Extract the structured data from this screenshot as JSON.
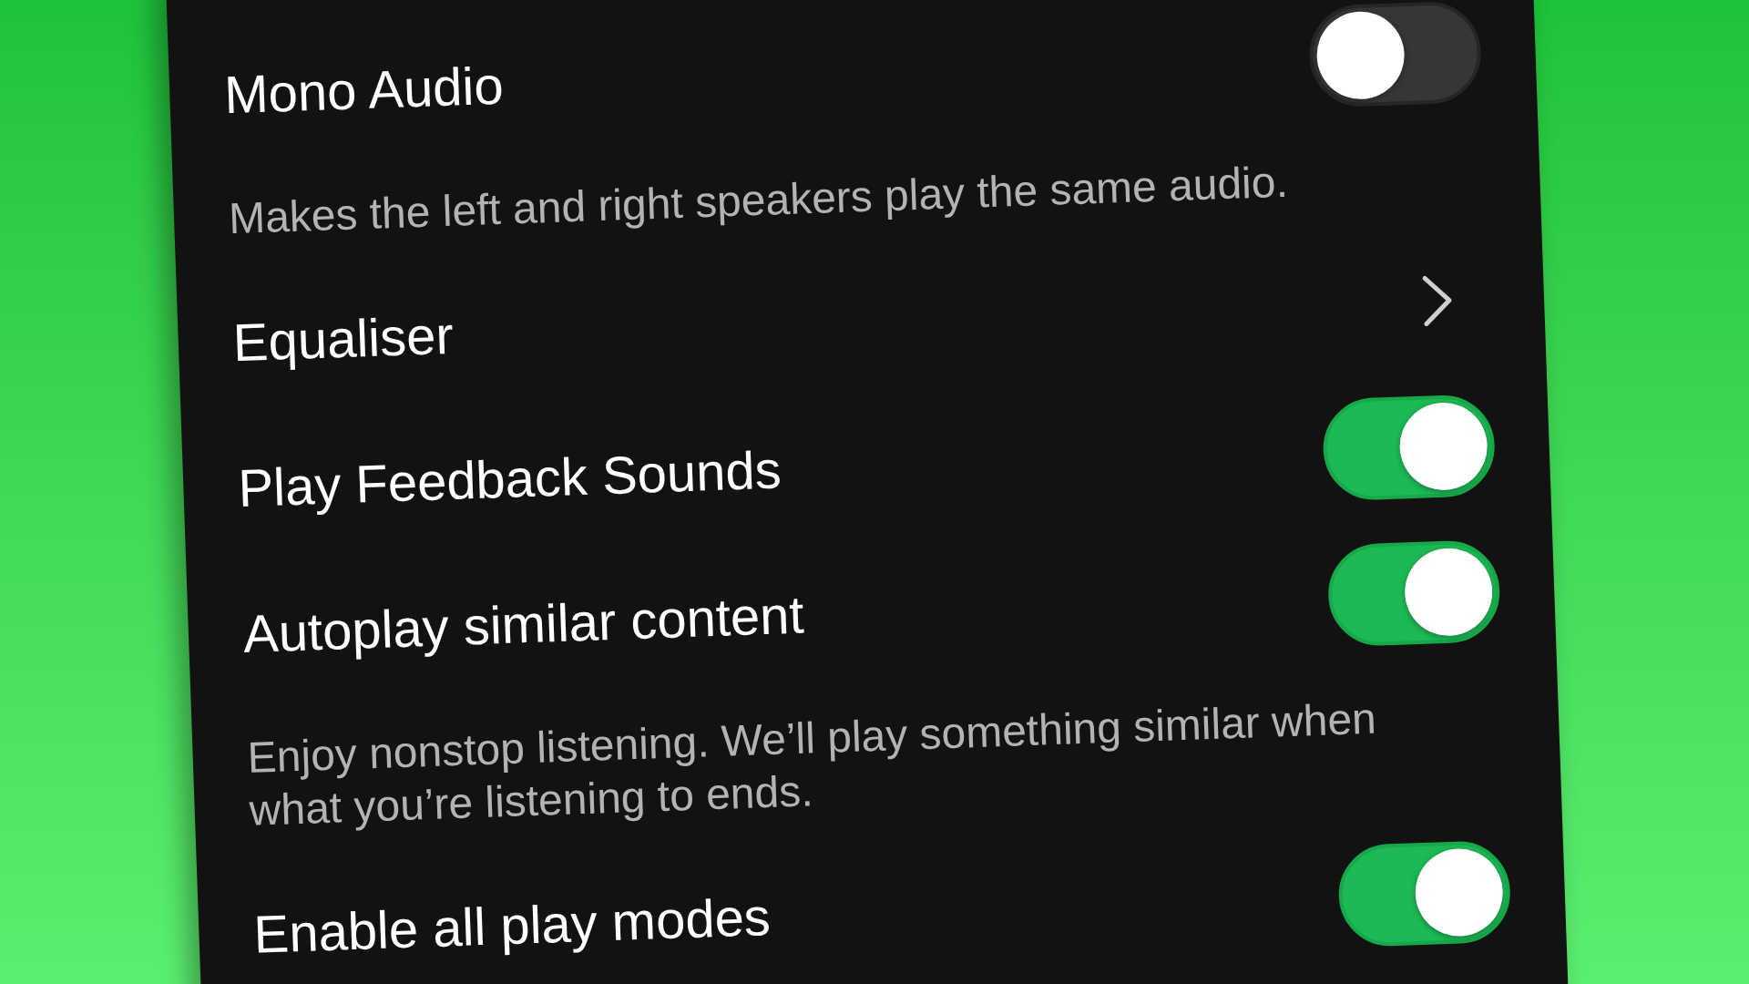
{
  "settings": [
    {
      "kind": "toggle",
      "label": "Mono Audio",
      "on": false,
      "description": "Makes the left and right speakers play the same audio."
    },
    {
      "kind": "link",
      "label": "Equaliser"
    },
    {
      "kind": "toggle",
      "label": "Play Feedback Sounds",
      "on": true
    },
    {
      "kind": "toggle",
      "label": "Autoplay similar content",
      "on": true,
      "description": "Enjoy nonstop listening. We’ll play something similar when what you’re listening to ends."
    },
    {
      "kind": "toggle",
      "label": "Enable all play modes",
      "on": true
    }
  ]
}
